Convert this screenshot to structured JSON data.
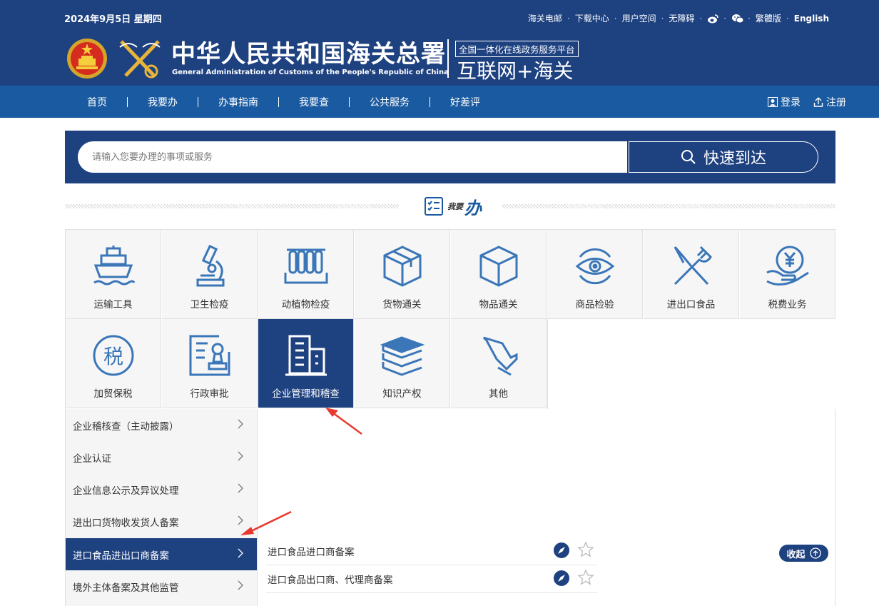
{
  "header": {
    "date": "2024年9月5日  星期四",
    "title_cn": "中华人民共和国海关总署",
    "title_en": "General Administration of Customs of the People's Republic of China",
    "platform": "全国一体化在线政务服务平台",
    "slogan": "互联网+海关",
    "links": [
      "海关电邮",
      "下载中心",
      "用户空间",
      "无障碍",
      "繁體版",
      "English"
    ],
    "icons": [
      "weibo-icon",
      "wechat-icon"
    ]
  },
  "nav": {
    "items": [
      "首页",
      "我要办",
      "办事指南",
      "我要查",
      "公共服务",
      "好差评"
    ],
    "login": "登录",
    "register": "注册"
  },
  "search": {
    "placeholder": "请输入您要办理的事项或服务",
    "button": "快速到达"
  },
  "section": {
    "small": "我要",
    "big": "办"
  },
  "categories": [
    {
      "label": "运输工具",
      "icon": "ship-icon"
    },
    {
      "label": "卫生检疫",
      "icon": "microscope-icon"
    },
    {
      "label": "动植物检疫",
      "icon": "test-tubes-icon"
    },
    {
      "label": "货物通关",
      "icon": "box-icon"
    },
    {
      "label": "物品通关",
      "icon": "cube-icon"
    },
    {
      "label": "商品检验",
      "icon": "eye-icon"
    },
    {
      "label": "进出口食品",
      "icon": "fork-knife-icon"
    },
    {
      "label": "税费业务",
      "icon": "yuan-hand-icon"
    },
    {
      "label": "加贸保税",
      "icon": "tax-icon"
    },
    {
      "label": "行政审批",
      "icon": "approval-icon"
    },
    {
      "label": "企业管理和稽查",
      "icon": "building-icon",
      "active": true
    },
    {
      "label": "知识产权",
      "icon": "books-icon"
    },
    {
      "label": "其他",
      "icon": "pin-icon"
    }
  ],
  "submenu": [
    "企业稽核查（主动披露）",
    "企业认证",
    "企业信息公示及异议处理",
    "进出口货物收发货人备案",
    "进口食品进出口商备案",
    "境外主体备案及其他监管"
  ],
  "submenu_active_index": 4,
  "services": [
    "进口食品进口商备案",
    "进口食品出口商、代理商备案"
  ],
  "collapse_label": "收起",
  "colors": {
    "header": "#1e4180",
    "navbar": "#1a5aa0",
    "arrow": "#e8392e"
  }
}
